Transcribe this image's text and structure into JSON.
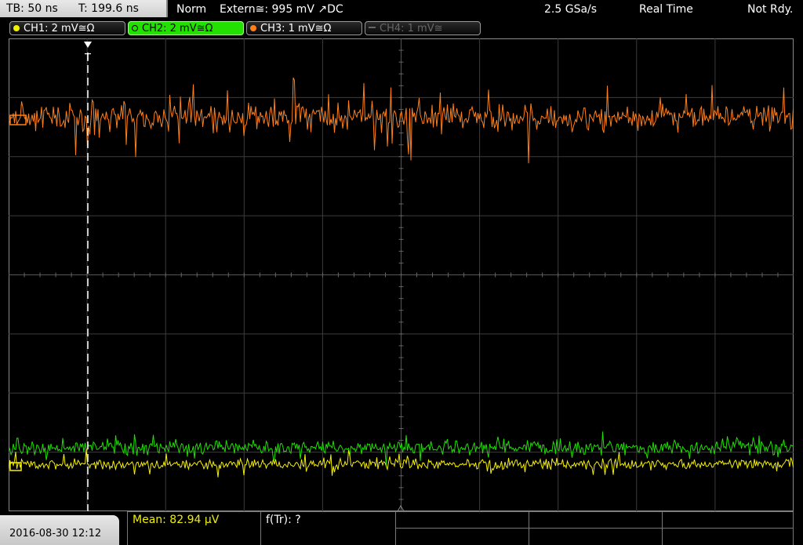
{
  "status": {
    "tb": "TB: 50 ns",
    "t": "T: 199.6 ns",
    "mode": "Norm",
    "trigger": "Extern≅: 995 mV ↗DC",
    "sample_rate": "2.5 GSa/s",
    "acquisition": "Real Time",
    "state": "Not Rdy."
  },
  "channels": [
    {
      "label": "CH1: 2 mV≅Ω",
      "color": "#f0f000"
    },
    {
      "label": "CH2: 2 mV≅Ω",
      "color": "#22e000"
    },
    {
      "label": "CH3: 1 mV≅Ω",
      "color": "#ff7f1a"
    },
    {
      "label": "CH4: 1 mV≅",
      "color": "#666666"
    }
  ],
  "trigger_marker": "T",
  "measurements": {
    "mean": "Mean: 82.94 µV",
    "ftr": "f(Tr): ?"
  },
  "datetime": "2016-08-30 12:12",
  "colors": {
    "ch1_trace": "#f5f000",
    "ch2_trace": "#1ee000",
    "ch3_trace": "#ff7f1a",
    "grid": "#505050",
    "accent_yellow": "#f0f000"
  }
}
